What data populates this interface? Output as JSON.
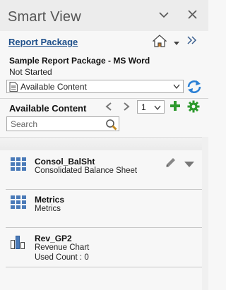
{
  "titlebar": {
    "title": "Smart View",
    "collapse_icon": "chevron-down-icon",
    "close_icon": "close-icon"
  },
  "header": {
    "link_underlined": "R",
    "link_rest": "eport Package",
    "home_icon": "home-icon",
    "menu_icon": "caret-down-icon",
    "more_icon": "double-chevron-right-icon"
  },
  "package": {
    "name": "Sample Report Package - MS Word",
    "status": "Not Started"
  },
  "content_dropdown": {
    "value": "Available Content",
    "refresh_icon": "refresh-icon"
  },
  "available": {
    "heading": "Available Content",
    "page": "1",
    "search_placeholder": "Search"
  },
  "items": [
    {
      "name": "Consol_BalSht",
      "description": "Consolidated Balance Sheet",
      "extra": "",
      "icon": "grid-icon"
    },
    {
      "name": "Metrics",
      "description": "Metrics",
      "extra": "",
      "icon": "grid-icon"
    },
    {
      "name": "Rev_GP2",
      "description": "Revenue Chart",
      "extra": "Used Count : 0",
      "icon": "bar-chart-icon"
    }
  ],
  "colors": {
    "link": "#1e4f8a",
    "accent_green": "#2e9a2e",
    "refresh_blue": "#2a7fd4",
    "grid_blue": "#4a7ab8"
  }
}
